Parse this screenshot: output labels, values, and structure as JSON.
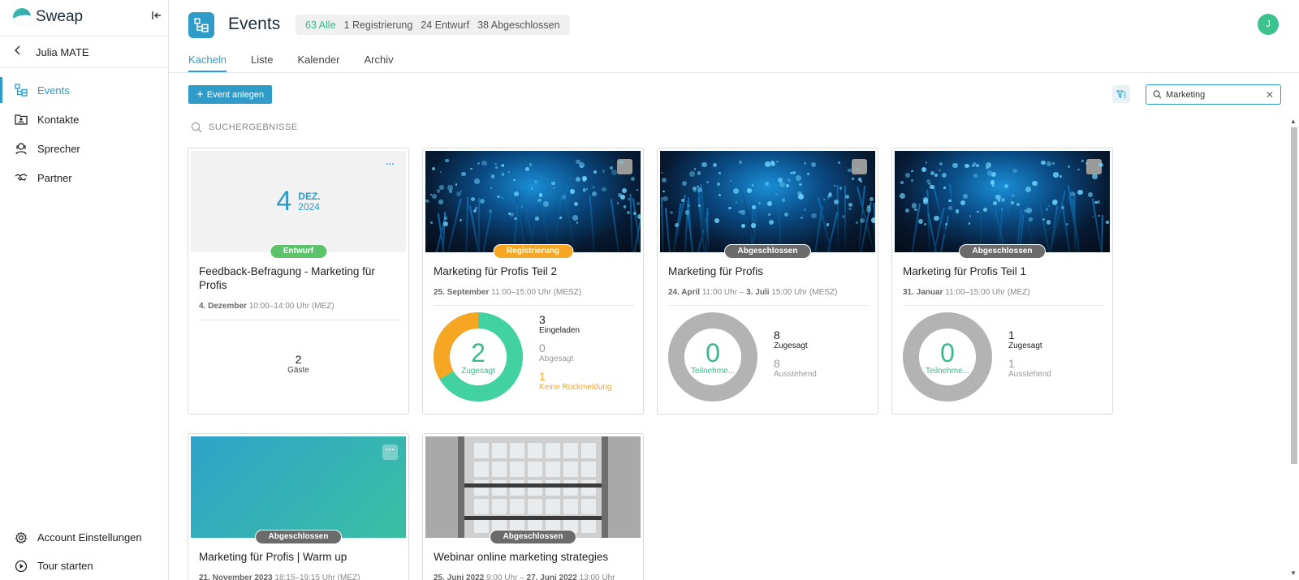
{
  "app": {
    "name": "Sweap"
  },
  "sidebar": {
    "back_label": "Julia MATE",
    "items": [
      {
        "label": "Events",
        "icon": "events-icon"
      },
      {
        "label": "Kontakte",
        "icon": "contacts-icon"
      },
      {
        "label": "Sprecher",
        "icon": "speaker-icon"
      },
      {
        "label": "Partner",
        "icon": "handshake-icon"
      }
    ],
    "bottom": [
      {
        "label": "Account Einstellungen",
        "icon": "gear-icon"
      },
      {
        "label": "Tour starten",
        "icon": "play-icon"
      }
    ]
  },
  "header": {
    "title": "Events",
    "counts": {
      "all": "63 Alle",
      "registration": "1 Registrierung",
      "draft": "24 Entwurf",
      "closed": "38 Abgeschlossen"
    },
    "avatar_initial": "J"
  },
  "tabs": [
    "Kacheln",
    "Liste",
    "Kalender",
    "Archiv"
  ],
  "toolbar": {
    "create_label": "Event anlegen",
    "search_value": "Marketing",
    "results_label": "SUCHERGEBNISSE"
  },
  "colors": {
    "accent": "#2f9bc8",
    "green": "#3ab98f",
    "orange": "#f5a623",
    "grey": "#b3b3b3"
  },
  "cards": [
    {
      "status": "Entwurf",
      "day": "4",
      "month": "DEZ.",
      "year": "2024",
      "title": "Feedback-Befragung - Marketing für Profis",
      "date_bold": "4. Dezember",
      "date_rest": " 10:00–14:00 Uhr (MEZ)",
      "guests_count": "2",
      "guests_label": "Gäste"
    },
    {
      "status": "Registrierung",
      "title": "Marketing für Profis Teil 2",
      "date_bold": "25. September",
      "date_rest": " 11:00–15:00 Uhr (MESZ)",
      "donut_value": "2",
      "donut_label": "Zugesagt",
      "donut_segments": [
        {
          "label": "Zugesagt",
          "value": 2
        },
        {
          "label": "Keine Rückmeldung",
          "value": 1
        }
      ],
      "stats": [
        {
          "n": "3",
          "l": "Eingeladen"
        },
        {
          "n": "0",
          "l": "Abgesagt"
        },
        {
          "n": "1",
          "l": "Keine Rückmeldung"
        }
      ]
    },
    {
      "status": "Abgeschlossen",
      "title": "Marketing für Profis",
      "date_bold": "24. April",
      "date_mid": " 11:00 Uhr – ",
      "date_bold2": "3. Juli",
      "date_rest": " 15:00 Uhr (MESZ)",
      "donut_value": "0",
      "donut_label": "Teilnehme...",
      "stats": [
        {
          "n": "8",
          "l": "Zugesagt"
        },
        {
          "n": "8",
          "l": "Ausstehend"
        }
      ]
    },
    {
      "status": "Abgeschlossen",
      "title": "Marketing für Profis Teil 1",
      "date_bold": "31. Januar",
      "date_rest": " 11:00–15:00 Uhr (MEZ)",
      "donut_value": "0",
      "donut_label": "Teilnehme...",
      "stats": [
        {
          "n": "1",
          "l": "Zugesagt"
        },
        {
          "n": "1",
          "l": "Ausstehend"
        }
      ]
    },
    {
      "status": "Abgeschlossen",
      "title": "Marketing für Profis | Warm up",
      "date_bold": "21. November 2023",
      "date_rest": " 18:15–19:15 Uhr (MEZ)"
    },
    {
      "status": "Abgeschlossen",
      "title": "Webinar online marketing strategies",
      "date_bold": "25. Juni 2022",
      "date_mid": " 9:00 Uhr – ",
      "date_bold2": "27. Juni 2022",
      "date_rest": " 13:00 Uhr"
    }
  ]
}
